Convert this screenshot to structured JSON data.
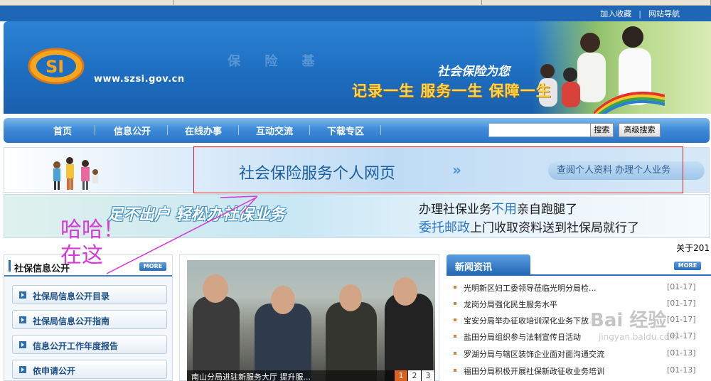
{
  "header": {
    "links": [
      "加入收藏",
      "网站导航"
    ]
  },
  "banner": {
    "site_url": "www.szsi.gov.cn",
    "faint_text": "保 险 基",
    "slogan_top": "社会保险为您",
    "slogan_main": "记录一生  服务一生  保障一生",
    "logo_text": "SI"
  },
  "nav": {
    "items": [
      "首页",
      "信息公开",
      "在线办事",
      "互动交流",
      "下载专区"
    ],
    "search_value": "",
    "search_button": "搜索",
    "advanced_button": "高级搜索"
  },
  "personal_banner": {
    "title": "社会保险服务个人网页",
    "chevron": "»",
    "links": "查阅个人资料  办理个人业务"
  },
  "noleave_banner": {
    "slogan": "足不出户 轻松办社保业务",
    "line1_prefix": "办理社保业务",
    "line1_highlight": "不用",
    "line1_suffix": "亲自跑腿了",
    "line2_highlight": "委托邮政",
    "line2_suffix": "上门收取资料送到社保局就行了"
  },
  "annotation": {
    "line1": "哈哈！",
    "line2": "在这"
  },
  "about_text": "关于201",
  "left": {
    "title": "社保信息公开",
    "more": "MORE",
    "items": [
      "社保局信息公开目录",
      "社保局信息公开指南",
      "信息公开工作年度报告",
      "依申请公开"
    ]
  },
  "middle": {
    "caption": "南山分局进驻新服务大厅 提升服...",
    "pages": [
      "1",
      "2",
      "3"
    ],
    "active_page": "1"
  },
  "news": {
    "title": "新闻资讯",
    "more": "MORE",
    "items": [
      {
        "text": "光明新区妇工委领导莅临光明分局检...",
        "date": "[01-17]"
      },
      {
        "text": "龙岗分局强化民生服务水平",
        "date": "[01-17]"
      },
      {
        "text": "宝安分局举办征收培训深化业务下放",
        "date": "[01-17]"
      },
      {
        "text": "盐田分局组织参与法制宣传日活动",
        "date": "[01-17]"
      },
      {
        "text": "罗湖分局与辖区装饰企业面对面沟通交流",
        "date": "[01-13]"
      },
      {
        "text": "福田分局积极开展社保新政征收业务培训",
        "date": "[01-13]"
      }
    ]
  },
  "watermark": {
    "main": "Bai 经验",
    "sub": "jingyan.baidu.com"
  },
  "colors": {
    "nav_blue": "#2b74c6",
    "banner_blue": "#1d6ec1",
    "annotation_pink": "#d63ad6",
    "highlight_box": "#d42020"
  }
}
